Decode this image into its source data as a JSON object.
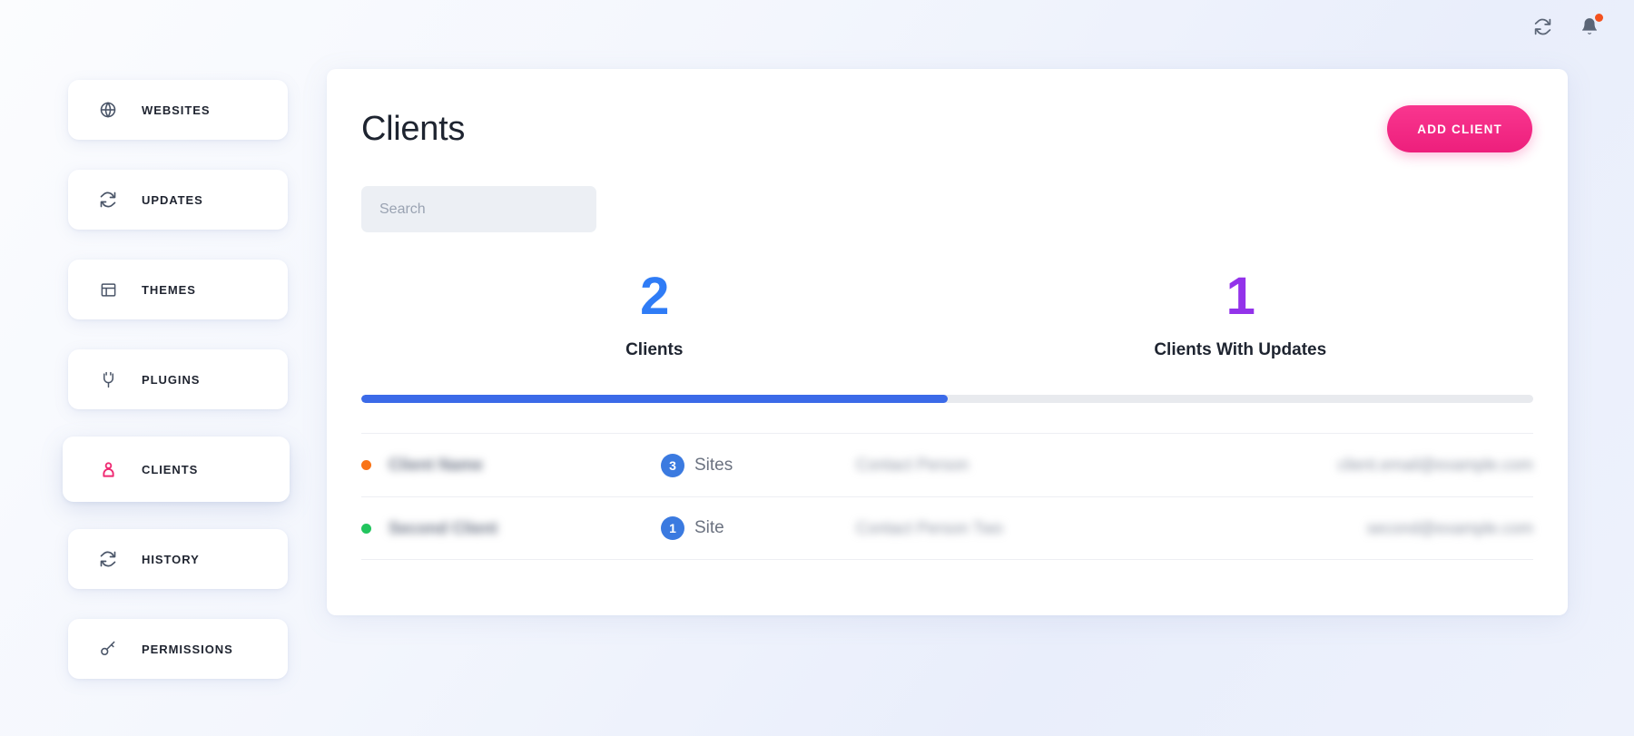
{
  "topbar": {
    "refresh_icon": "refresh-icon",
    "notifications_icon": "bell-icon",
    "has_notification": true,
    "notification_dot_color": "#f4511e"
  },
  "sidebar": {
    "items": [
      {
        "label": "WEBSITES",
        "icon": "globe-icon",
        "active": false
      },
      {
        "label": "UPDATES",
        "icon": "refresh-icon",
        "active": false
      },
      {
        "label": "THEMES",
        "icon": "window-icon",
        "active": false
      },
      {
        "label": "PLUGINS",
        "icon": "plug-icon",
        "active": false
      },
      {
        "label": "CLIENTS",
        "icon": "user-icon",
        "active": true
      },
      {
        "label": "HISTORY",
        "icon": "refresh-icon",
        "active": false
      },
      {
        "label": "PERMISSIONS",
        "icon": "key-icon",
        "active": false
      }
    ],
    "active_color": "#ef2a72"
  },
  "main": {
    "title": "Clients",
    "add_button_label": "ADD CLIENT",
    "add_button_color": "#f72585",
    "search": {
      "placeholder": "Search",
      "value": ""
    },
    "stats": [
      {
        "value": "2",
        "label": "Clients",
        "color": "#2f7cf6"
      },
      {
        "value": "1",
        "label": "Clients With Updates",
        "color": "#9333ea"
      }
    ],
    "progress": {
      "percent": 50,
      "fill_color": "#3b6ae8",
      "track_color": "#e8eaee"
    },
    "rows": [
      {
        "status_color": "#f97316",
        "name": "Client Name",
        "sites_count": "3",
        "sites_label": "Sites",
        "contact": "Contact Person",
        "email": "client.email@example.com"
      },
      {
        "status_color": "#22c55e",
        "name": "Second Client",
        "sites_count": "1",
        "sites_label": "Site",
        "contact": "Contact Person Two",
        "email": "second@example.com"
      }
    ]
  }
}
